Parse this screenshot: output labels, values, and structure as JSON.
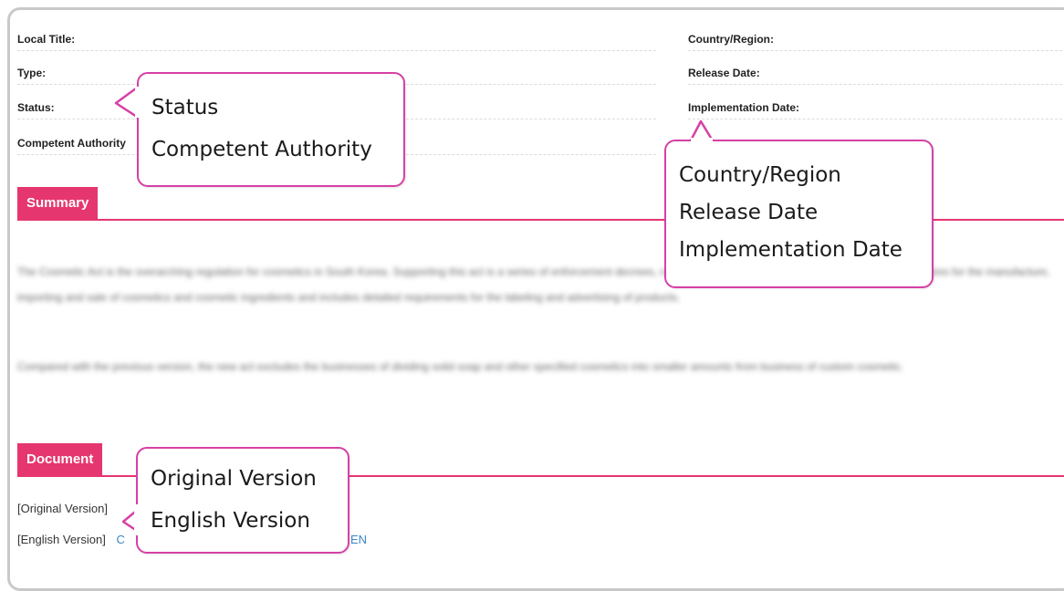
{
  "fields": {
    "local_title": "Local Title:",
    "type": "Type:",
    "status": "Status:",
    "competent_authority": "Competent Authority",
    "country_region": "Country/Region:",
    "release_date": "Release Date:",
    "implementation_date": "Implementation Date:"
  },
  "sections": {
    "summary": "Summary",
    "document": "Document"
  },
  "summary_paragraphs": [
    "The Cosmetic Act is the overarching regulation for cosmetics in South Korea. Supporting this act is a series of enforcement decrees, rules and guidance documents. This act provides measures for the manufacture, importing and sale of cosmetics and cosmetic ingredients and includes detailed requirements for the labeling and advertising of products.",
    "Compared with the previous version, the new act excludes the businesses of dividing solid soap and other specified cosmetics into smaller amounts from business of custom cosmetic."
  ],
  "documents": {
    "original_label": "[Original Version]",
    "english_label": "[English Version]",
    "english_link_start": "C",
    "english_link_end": "EN"
  },
  "callouts": {
    "status_authority": [
      "Status",
      "Competent Authority"
    ],
    "dates": [
      "Country/Region",
      "Release Date",
      "Implementation Date"
    ],
    "versions": [
      "Original Version",
      "English Version"
    ]
  },
  "colors": {
    "accent": "#e6366f",
    "callout_border": "#d640a6",
    "link": "#3b86c6"
  }
}
